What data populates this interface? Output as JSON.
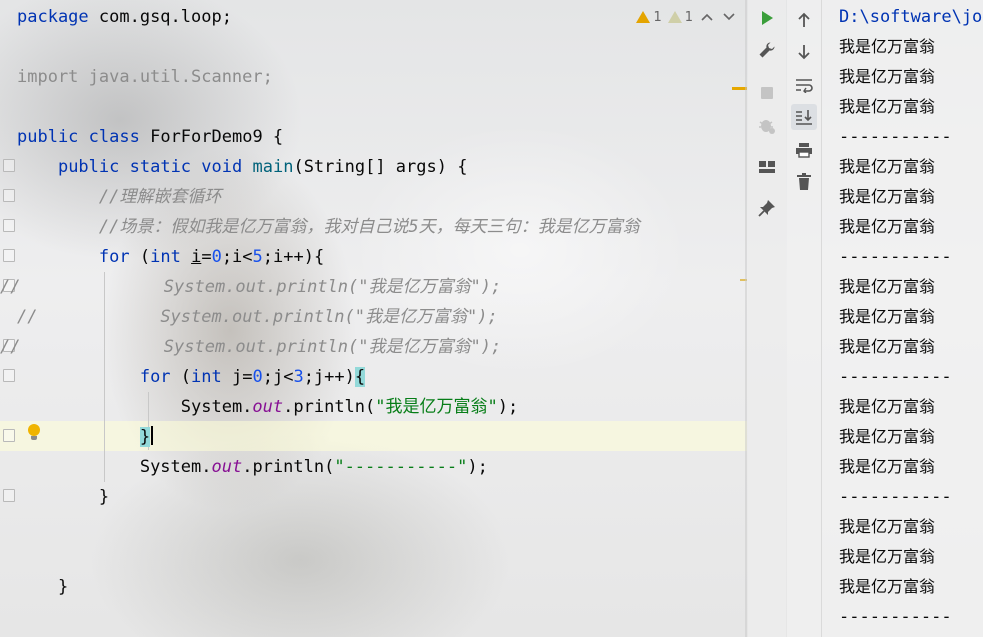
{
  "editor": {
    "lines": {
      "l1_kw": "package",
      "l1_rest": " com.gsq.loop;",
      "l3": "import java.util.Scanner;",
      "l5_public": "public",
      "l5_class": "class",
      "l5_name": " ForForDemo9 {",
      "l6_public": "public",
      "l6_static": "static",
      "l6_void": "void",
      "l6_main": "main",
      "l6_rest": "(String[] args) {",
      "l7_comment": "//理解嵌套循环",
      "l8_comment": "//场景：假如我是亿万富翁，我对自己说5天，每天三句：我是亿万富翁",
      "l9_for": "for",
      "l9_open": " (",
      "l9_int": "int",
      "l9_i": "i",
      "l9_eq": "=",
      "l9_zero": "0",
      "l9_mid": ";i<",
      "l9_five": "5",
      "l9_end": ";i++){",
      "commented_prefix": "//",
      "commented_body": "System.out.println(\"我是亿万富翁\");",
      "l13_for": "for",
      "l13_open": " (",
      "l13_int": "int",
      "l13_j": " j=",
      "l13_zero": "0",
      "l13_mid": ";j<",
      "l13_three": "3",
      "l13_end": ";j++)",
      "l13_brace": "{",
      "l14_system": "System.",
      "l14_out": "out",
      "l14_println": ".println(",
      "l14_str": "\"我是亿万富翁\"",
      "l14_end": ");",
      "l15_brace": "}",
      "l16_system": "System.",
      "l16_out": "out",
      "l16_println": ".println(",
      "l16_str": "\"-----------\"",
      "l16_end": ");",
      "l17_brace": "}",
      "l20_brace": "}"
    },
    "inspection": {
      "warning_count": "1",
      "weak_warning_count": "1",
      "up_icon": "chevron-up-icon",
      "down_icon": "chevron-down-icon",
      "warning_color": "#e4a400"
    },
    "gutter": {
      "bulb_icon": "lightbulb-icon"
    }
  },
  "run_toolbar": [
    {
      "icon": "run-icon"
    },
    {
      "icon": "wrench-icon"
    },
    {
      "icon": "stop-icon"
    },
    {
      "icon": "debug-bug-icon"
    },
    {
      "icon": "layout-icon"
    },
    {
      "icon": "pin-icon"
    }
  ],
  "console_toolbar": [
    {
      "icon": "arrow-up-icon"
    },
    {
      "icon": "arrow-down-icon"
    },
    {
      "icon": "soft-wrap-icon"
    },
    {
      "icon": "scroll-to-end-icon"
    },
    {
      "icon": "print-icon"
    },
    {
      "icon": "trash-icon"
    }
  ],
  "console": {
    "path": "D:\\software\\jo",
    "line1": "我是亿万富翁",
    "line2": "我是亿万富翁",
    "line3": "我是亿万富翁",
    "sep1": "-----------",
    "line4": "我是亿万富翁",
    "line5": "我是亿万富翁",
    "line6": "我是亿万富翁",
    "sep2": "-----------",
    "line7": "我是亿万富翁",
    "line8": "我是亿万富翁",
    "line9": "我是亿万富翁",
    "sep3": "-----------",
    "line10": "我是亿万富翁",
    "line11": "我是亿万富翁",
    "line12": "我是亿万富翁",
    "sep4": "-----------",
    "line13": "我是亿万富翁",
    "line14": "我是亿万富翁",
    "line15": "我是亿万富翁",
    "sep5": "-----------"
  },
  "colors": {
    "keyword": "#0033b3",
    "string": "#067d17",
    "number": "#1750eb",
    "field": "#871094",
    "comment": "#8c8c8c",
    "run_green": "#3a9e3a"
  }
}
